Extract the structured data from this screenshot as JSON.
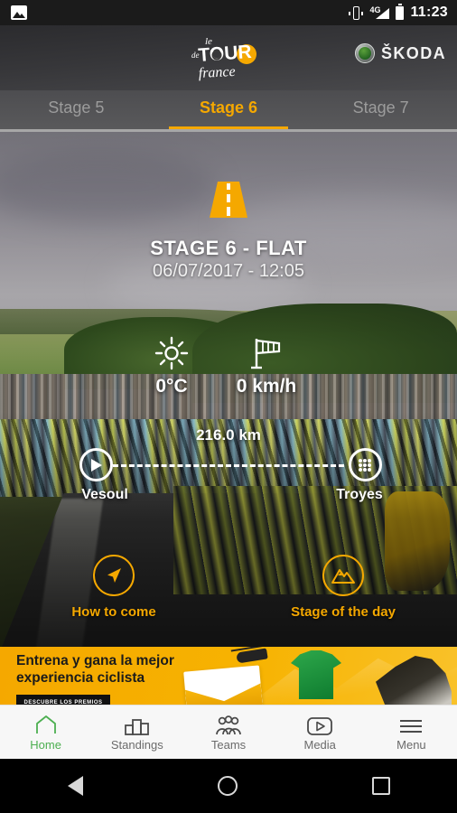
{
  "statusbar": {
    "image_icon": "image-icon",
    "vibrate_icon": "vibrate-icon",
    "network_label": "4G",
    "battery_icon": "battery-icon",
    "time": "11:23"
  },
  "header": {
    "logo_alt": "le Tour de France",
    "logo_line1": "le",
    "logo_line2": "TOUR",
    "logo_line3": "de",
    "logo_line4": "FRANCE",
    "sponsor": "ŠKODA",
    "accent_color": "#f5a800"
  },
  "tabs": [
    {
      "label": "Stage 5",
      "active": false
    },
    {
      "label": "Stage 6",
      "active": true
    },
    {
      "label": "Stage 7",
      "active": false
    }
  ],
  "stage": {
    "icon": "road-icon",
    "title": "STAGE 6 - FLAT",
    "datetime": "06/07/2017 - 12:05",
    "weather": [
      {
        "icon": "sun-icon",
        "value": "0°C",
        "name": "temperature"
      },
      {
        "icon": "windsock-icon",
        "value": "0 km/h",
        "name": "wind-speed"
      }
    ],
    "distance": "216.0 km",
    "start_city": "Vesoul",
    "finish_city": "Troyes",
    "start_icon": "play-circle-icon",
    "finish_icon": "checkered-flag-icon"
  },
  "actions": [
    {
      "label": "How to come",
      "icon": "navigation-arrow-icon"
    },
    {
      "label": "Stage of the day",
      "icon": "mountain-icon"
    }
  ],
  "ad": {
    "line1": "Entrena y gana la mejor",
    "line2": "experiencia ciclista",
    "cta": "DESCUBRE LOS PREMIOS",
    "background_color": "#f5a800"
  },
  "bottom_nav": [
    {
      "label": "Home",
      "icon": "home-icon",
      "active": true
    },
    {
      "label": "Standings",
      "icon": "bar-chart-icon",
      "active": false
    },
    {
      "label": "Teams",
      "icon": "people-icon",
      "active": false
    },
    {
      "label": "Media",
      "icon": "play-box-icon",
      "active": false
    },
    {
      "label": "Menu",
      "icon": "hamburger-icon",
      "active": false
    }
  ],
  "android_nav": {
    "back": "back-button",
    "home": "home-button",
    "recents": "recents-button"
  }
}
